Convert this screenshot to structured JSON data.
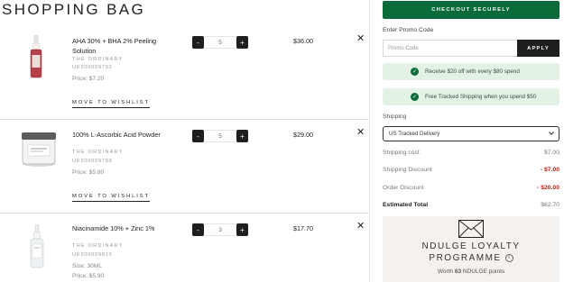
{
  "page_title": "SHOPPING BAG",
  "items": [
    {
      "name": "AHA 30% + BHA 2% Peeling Solution",
      "brand": "THE ORDINARY",
      "sku": "UK200029791",
      "price_label": "Price: $7.20",
      "quantity": "5",
      "line_total": "$36.00",
      "wishlist_label": "MOVE TO WISHLIST",
      "image_icon": "dropper-bottle-red-icon"
    },
    {
      "name": "100% L-Ascorbic Acid Powder",
      "brand": "THE ORDINARY",
      "sku": "UK200029789",
      "price_label": "Price: $5.80",
      "quantity": "5",
      "line_total": "$29.00",
      "wishlist_label": "MOVE TO WISHLIST",
      "image_icon": "powder-jar-icon"
    },
    {
      "name": "Niacinamide 10% + Zinc 1%",
      "brand": "THE ORDINARY",
      "sku": "UK200029815",
      "size_label": "Size: 30ML",
      "price_label": "Price: $5.90",
      "quantity": "3",
      "line_total": "$17.70",
      "image_icon": "dropper-bottle-clear-icon"
    }
  ],
  "qty_controls": {
    "minus": "-",
    "plus": "+"
  },
  "remove_glyph": "✕",
  "checkout": {
    "label": "CHECKOUT SECURELY",
    "color": "#0b6b3a"
  },
  "promo": {
    "label": "Enter Promo Code",
    "placeholder": "Promo Code",
    "apply_label": "APPLY"
  },
  "banners": [
    "Receive $20 off with every $80 spend",
    "Free Tracked Shipping when you spend $50"
  ],
  "shipping": {
    "label": "Shipping",
    "selected": "US Tracked Delivery"
  },
  "summary": [
    {
      "label": "Shipping cost",
      "value": "$7.00",
      "style": "normal"
    },
    {
      "label": "Shipping Discount",
      "value": "- $7.00",
      "style": "red"
    },
    {
      "label": "Order Discount",
      "value": "- $20.00",
      "style": "red"
    },
    {
      "label": "Estimated Total",
      "value": "$62.70",
      "style": "total"
    }
  ],
  "loyalty": {
    "title_line1": "NDULGE LOYALTY",
    "title_line2": "PROGRAMME",
    "info_glyph": "i",
    "worth_prefix": "Worth",
    "points": "63",
    "worth_suffix": "NDULGE points"
  },
  "colors": {
    "accent_green": "#0b6b3a",
    "discount_red": "#c41c12",
    "banner_bg": "#e4f2e6",
    "loyalty_bg": "#f4f1ee"
  }
}
